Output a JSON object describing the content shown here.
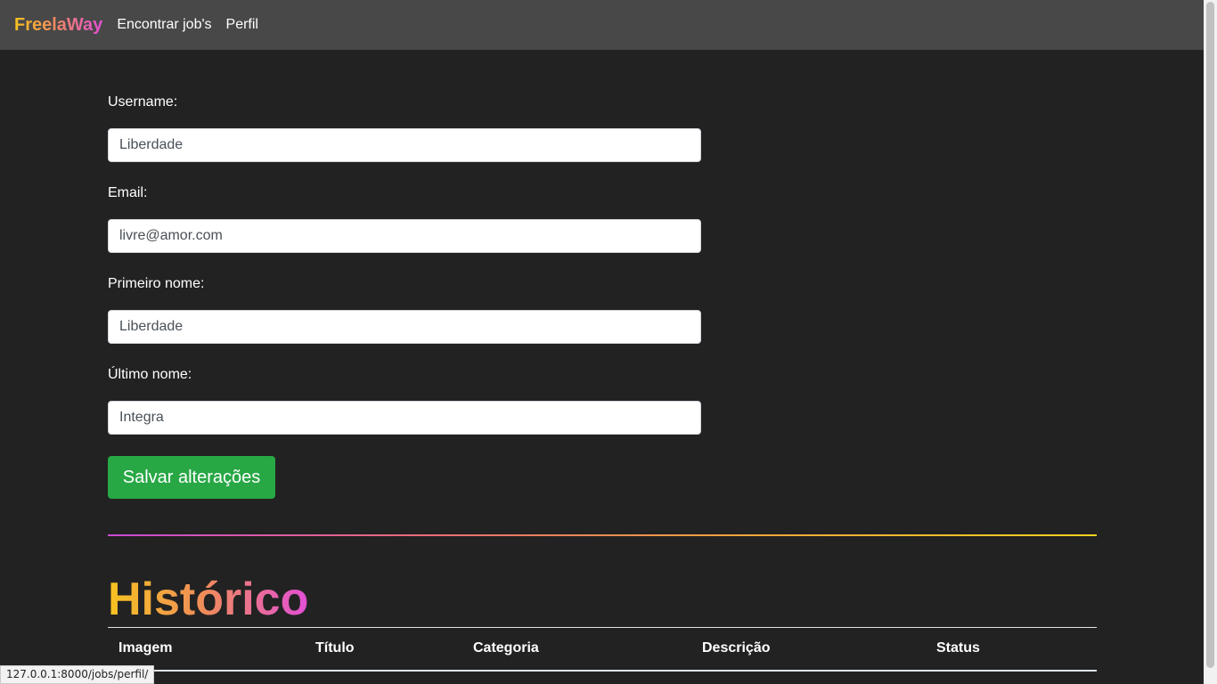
{
  "nav": {
    "brand": "FreelaWay",
    "links": [
      "Encontrar job's",
      "Perfil"
    ]
  },
  "form": {
    "fields": [
      {
        "label": "Username:",
        "value": "Liberdade"
      },
      {
        "label": "Email:",
        "value": "livre@amor.com"
      },
      {
        "label": "Primeiro nome:",
        "value": "Liberdade"
      },
      {
        "label": "Último nome:",
        "value": "Integra"
      }
    ],
    "submit_label": "Salvar alterações"
  },
  "history": {
    "title": "Histórico",
    "columns": [
      "Imagem",
      "Título",
      "Categoria",
      "Descrição",
      "Status"
    ]
  },
  "status_bar": {
    "url": "127.0.0.1:8000/jobs/perfil/"
  },
  "colors": {
    "background": "#222222",
    "navbar": "#484848",
    "save_button": "#28a745"
  }
}
